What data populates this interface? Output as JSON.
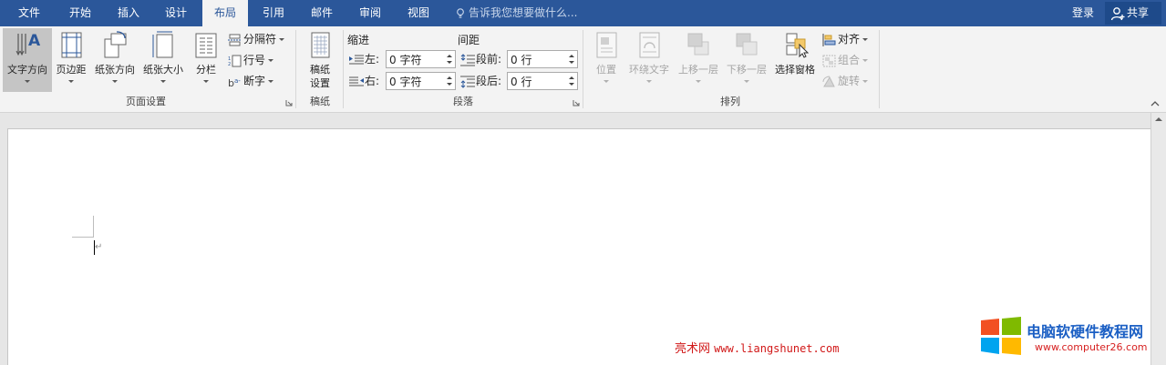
{
  "tabs": [
    {
      "label": "文件",
      "active": false
    },
    {
      "label": "开始",
      "active": false
    },
    {
      "label": "插入",
      "active": false
    },
    {
      "label": "设计",
      "active": false
    },
    {
      "label": "布局",
      "active": true
    },
    {
      "label": "引用",
      "active": false
    },
    {
      "label": "邮件",
      "active": false
    },
    {
      "label": "审阅",
      "active": false
    },
    {
      "label": "视图",
      "active": false
    }
  ],
  "tell_me": "告诉我您想要做什么...",
  "login": "登录",
  "share": "共享",
  "page_setup": {
    "label": "页面设置",
    "text_direction": "文字方向",
    "margins": "页边距",
    "orientation": "纸张方向",
    "size": "纸张大小",
    "columns": "分栏",
    "breaks": "分隔符",
    "line_numbers": "行号",
    "hyphenation": "断字"
  },
  "manuscript": {
    "label": "稿纸",
    "settings_line1": "稿纸",
    "settings_line2": "设置"
  },
  "paragraph": {
    "label": "段落",
    "indent_header": "缩进",
    "spacing_header": "间距",
    "left_label": "左:",
    "left_value": "0 字符",
    "right_label": "右:",
    "right_value": "0 字符",
    "before_label": "段前:",
    "before_value": "0 行",
    "after_label": "段后:",
    "after_value": "0 行"
  },
  "arrange": {
    "label": "排列",
    "position": "位置",
    "wrap_text": "环绕文字",
    "bring_forward": "上移一层",
    "send_backward": "下移一层",
    "selection_pane": "选择窗格",
    "align": "对齐",
    "group": "组合",
    "rotate": "旋转"
  },
  "watermark": {
    "site_name": "亮术网",
    "site_url": "www.liangshunet.com",
    "brand": "电脑软硬件教程网",
    "brand_url": "www.computer26.com"
  },
  "colors": {
    "accent": "#2b579a",
    "ribbon_bg": "#f3f3f3",
    "watermark_red": "#d11818",
    "brand_blue": "#1b5fc4"
  }
}
